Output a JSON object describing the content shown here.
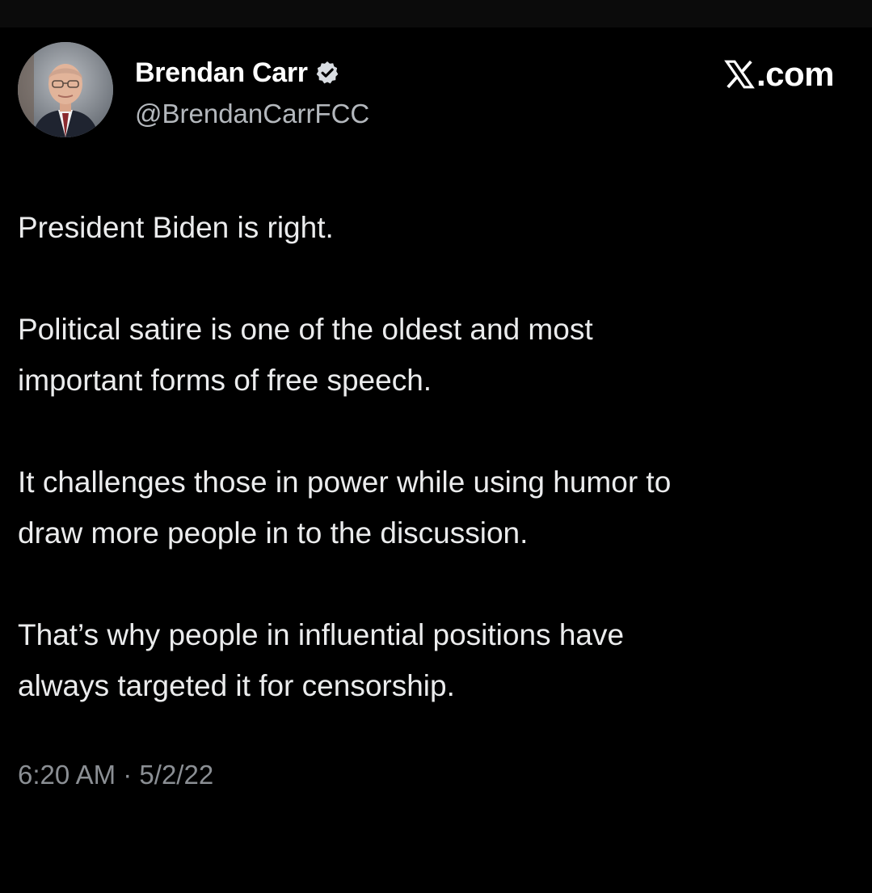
{
  "author": {
    "name": "Brendan Carr",
    "handle": "@BrendanCarrFCC",
    "verified": true
  },
  "brand": {
    "label": ".com",
    "icon": "x-logo-icon"
  },
  "tweet": {
    "paragraphs": [
      "President Biden is right.",
      "Political satire is one of the oldest and most\nimportant forms of free speech.",
      "It challenges those in power while using humor to\ndraw more people in to the discussion.",
      "That’s why people in influential positions have\nalways targeted it for censorship."
    ],
    "time": "6:20 AM",
    "separator": "·",
    "date": "5/2/22"
  },
  "colors": {
    "background": "#000000",
    "text": "#ebeced",
    "secondary_text": "#8b8f94",
    "badge": "#d9dde2"
  }
}
